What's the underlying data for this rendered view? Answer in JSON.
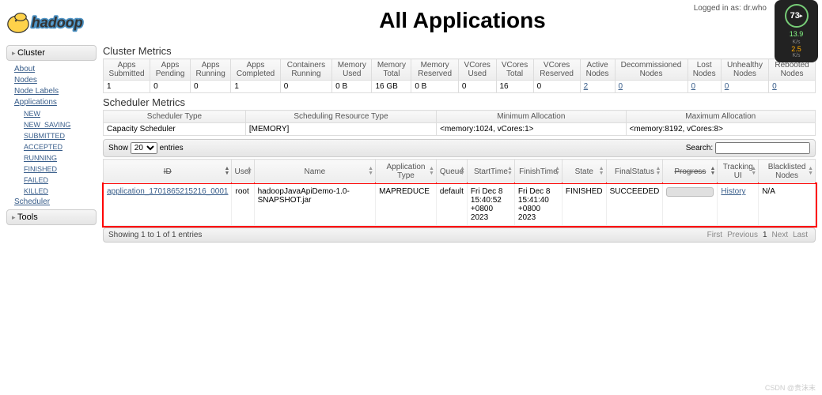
{
  "login_text": "Logged in as: dr.who",
  "page_title": "All Applications",
  "widget": {
    "pct": "73",
    "rate1": "13.9",
    "unit1": "K/s",
    "rate2": "2.5",
    "unit2": "K/s"
  },
  "sidebar": {
    "cluster_head": "Cluster",
    "tools_head": "Tools",
    "items": [
      "About",
      "Nodes",
      "Node Labels",
      "Applications"
    ],
    "subitems": [
      "NEW",
      "NEW_SAVING",
      "SUBMITTED",
      "ACCEPTED",
      "RUNNING",
      "FINISHED",
      "FAILED",
      "KILLED"
    ],
    "scheduler": "Scheduler"
  },
  "cluster_metrics": {
    "title": "Cluster Metrics",
    "headers": [
      "Apps Submitted",
      "Apps Pending",
      "Apps Running",
      "Apps Completed",
      "Containers Running",
      "Memory Used",
      "Memory Total",
      "Memory Reserved",
      "VCores Used",
      "VCores Total",
      "VCores Reserved",
      "Active Nodes",
      "Decommissioned Nodes",
      "Lost Nodes",
      "Unhealthy Nodes",
      "Rebooted Nodes"
    ],
    "values": [
      "1",
      "0",
      "0",
      "1",
      "0",
      "0 B",
      "16 GB",
      "0 B",
      "0",
      "16",
      "0",
      "2",
      "0",
      "0",
      "0",
      "0"
    ],
    "link_cols": [
      11,
      12,
      13,
      14,
      15
    ]
  },
  "scheduler_metrics": {
    "title": "Scheduler Metrics",
    "headers": [
      "Scheduler Type",
      "Scheduling Resource Type",
      "Minimum Allocation",
      "Maximum Allocation"
    ],
    "values": [
      "Capacity Scheduler",
      "[MEMORY]",
      "<memory:1024, vCores:1>",
      "<memory:8192, vCores:8>"
    ]
  },
  "datatable": {
    "show_label": "Show",
    "show_val": "20",
    "entries_label": "entries",
    "search_label": "Search:",
    "headers": [
      "ID",
      "User",
      "Name",
      "Application Type",
      "Queue",
      "StartTime",
      "FinishTime",
      "State",
      "FinalStatus",
      "Progress",
      "Tracking UI",
      "Blacklisted Nodes"
    ],
    "sorted_cols": [
      0,
      9
    ],
    "row": {
      "id": "application_1701865215216_0001",
      "user": "root",
      "name": "hadoopJavaApiDemo-1.0-SNAPSHOT.jar",
      "type": "MAPREDUCE",
      "queue": "default",
      "start": "Fri Dec 8 15:40:52 +0800 2023",
      "finish": "Fri Dec 8 15:41:40 +0800 2023",
      "state": "FINISHED",
      "final": "SUCCEEDED",
      "tracking": "History",
      "blacklisted": "N/A"
    },
    "info": "Showing 1 to 1 of 1 entries",
    "pager": [
      "First",
      "Previous",
      "1",
      "Next",
      "Last"
    ]
  },
  "watermark": "CSDN @贵沫末"
}
